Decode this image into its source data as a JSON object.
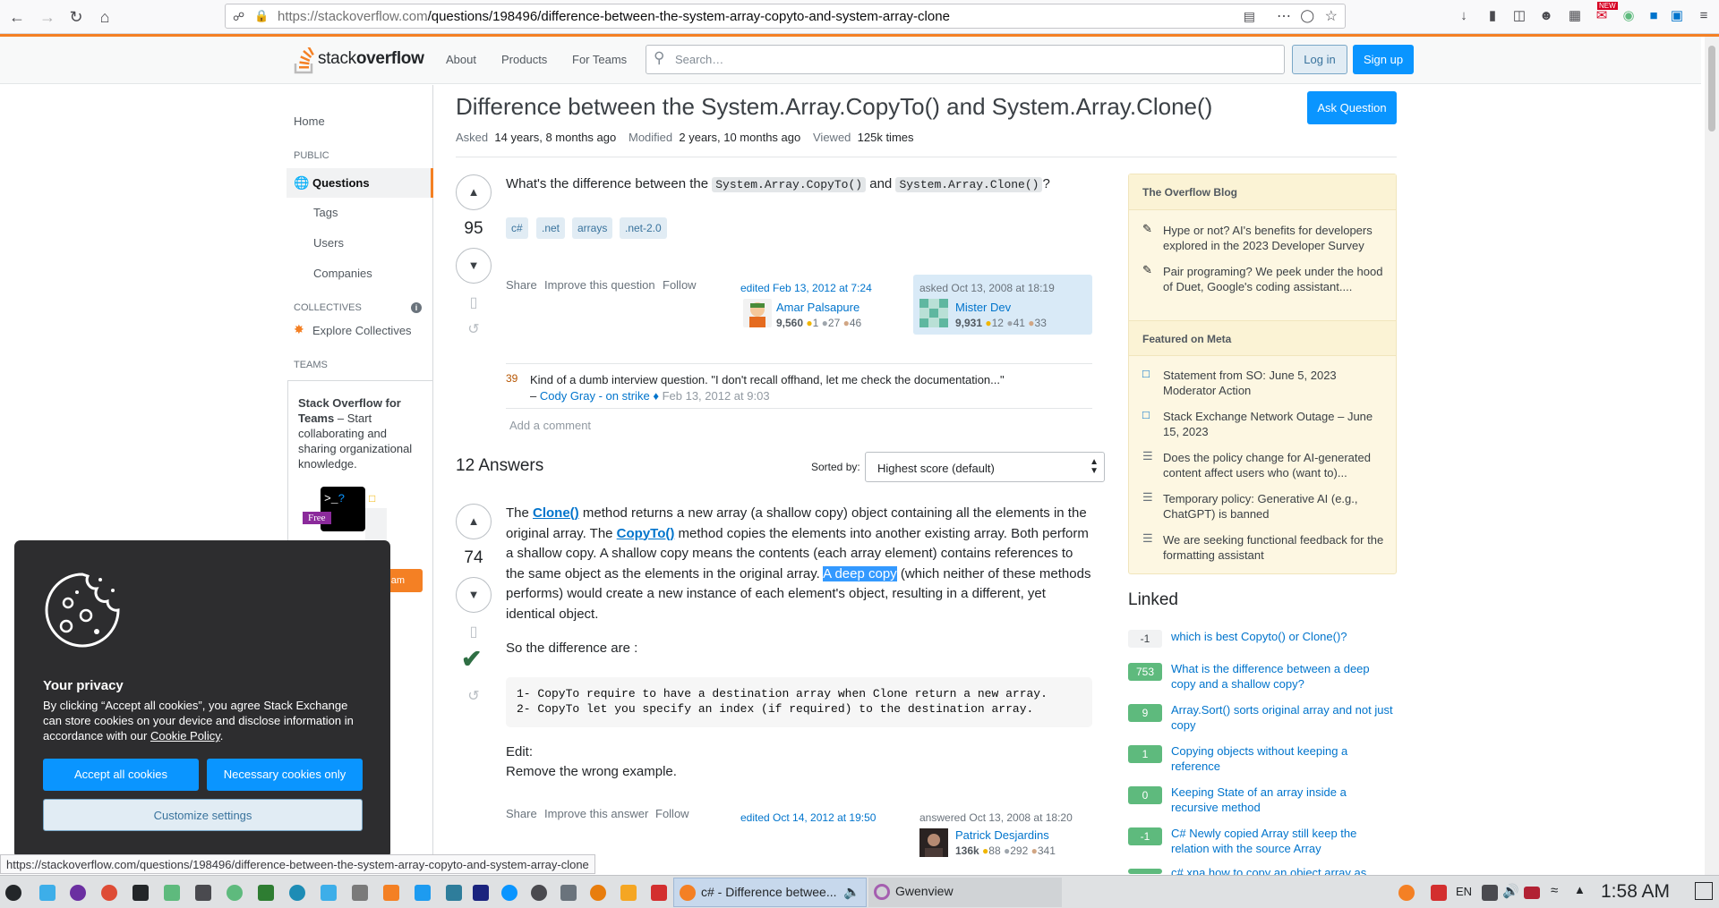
{
  "browser": {
    "url_host": "https://stackoverflow.com",
    "url_path": "/questions/198496/difference-between-the-system-array-copyto-and-system-array-clone",
    "status_url": "https://stackoverflow.com/questions/198496/difference-between-the-system-array-copyto-and-system-array-clone"
  },
  "header": {
    "logo_light": "stack",
    "logo_bold": "overflow",
    "nav": [
      "About",
      "Products",
      "For Teams"
    ],
    "search_placeholder": "Search…",
    "login": "Log in",
    "signup": "Sign up"
  },
  "left_nav": {
    "home": "Home",
    "public": "PUBLIC",
    "questions": "Questions",
    "tags": "Tags",
    "users": "Users",
    "companies": "Companies",
    "collectives": "COLLECTIVES",
    "explore_collectives": "Explore Collectives",
    "teams": "TEAMS",
    "teams_title": "Stack Overflow for Teams",
    "teams_desc": " – Start collaborating and sharing organizational knowledge.",
    "free_badge": "Free",
    "team_button_partial": "am"
  },
  "question": {
    "title": "Difference between the System.Array.CopyTo() and System.Array.Clone()",
    "ask_button": "Ask Question",
    "asked_label": "Asked",
    "asked_value": "14 years, 8 months ago",
    "modified_label": "Modified",
    "modified_value": "2 years, 10 months ago",
    "viewed_label": "Viewed",
    "viewed_value": "125k times",
    "votes": "95",
    "body_before": "What's the difference between the ",
    "code1": "System.Array.CopyTo()",
    "body_mid": " and ",
    "code2": "System.Array.Clone()",
    "body_after": "?",
    "tags": [
      "c#",
      ".net",
      "arrays",
      ".net-2.0"
    ],
    "menu": [
      "Share",
      "Improve this question",
      "Follow"
    ],
    "edited": "edited Feb 13, 2012 at 7:24",
    "editor_name": "Amar Palsapure",
    "editor_rep": "9,560",
    "editor_badges": [
      "1",
      "27",
      "46"
    ],
    "asked_card": "asked Oct 13, 2008 at 18:19",
    "asker_name": "Mister Dev",
    "asker_rep": "9,931",
    "asker_badges": [
      "12",
      "41",
      "33"
    ],
    "comment_score": "39",
    "comment_text": "Kind of a dumb interview question. \"I don't recall offhand, let me check the documentation...\"",
    "comment_dash": "–",
    "comment_user": "Cody Gray - on strike",
    "comment_diamond": "♦",
    "comment_date": "Feb 13, 2012 at 9:03",
    "add_comment": "Add a comment"
  },
  "answers": {
    "count_label": "12 Answers",
    "sorted_by": "Sorted by:",
    "sort_value": "Highest score (default)",
    "votes": "74",
    "p1_a": "The ",
    "p1_clone": "Clone()",
    "p1_b": " method returns a new array (a shallow copy) object containing all the elements in the original array. The ",
    "p1_copyto": "CopyTo()",
    "p1_c": " method copies the elements into another existing array. Both perform a shallow copy. A shallow copy means the contents (each array element) contains references to the same object as the elements in the original array. ",
    "p1_highlight": "A deep copy",
    "p1_d": " (which neither of these methods performs) would create a new instance of each element's object, resulting in a different, yet identical object.",
    "p2": "So the difference are :",
    "code_line1": "1- CopyTo require to have a destination array when Clone return a new array.",
    "code_line2": "2- CopyTo let you specify an index (if required) to the destination array.",
    "edit_label": "Edit:",
    "edit_text": "Remove the wrong example.",
    "menu": [
      "Share",
      "Improve this answer",
      "Follow"
    ],
    "edited": "edited Oct 14, 2012 at 19:50",
    "answered": "answered Oct 13, 2008 at 18:20",
    "answerer_name": "Patrick Desjardins",
    "answerer_rep": "136k",
    "answerer_badges": [
      "88",
      "292",
      "341"
    ]
  },
  "sidebar": {
    "blog_title": "The Overflow Blog",
    "blog_items": [
      "Hype or not? AI's benefits for developers explored in the 2023 Developer Survey",
      "Pair programing? We peek under the hood of Duet, Google's coding assistant...."
    ],
    "meta_title": "Featured on Meta",
    "meta_items": [
      "Statement from SO: June 5, 2023 Moderator Action",
      "Stack Exchange Network Outage – June 15, 2023",
      "Does the policy change for AI-generated content affect users who (want to)...",
      "Temporary policy: Generative AI (e.g., ChatGPT) is banned",
      "We are seeking functional feedback for the formatting assistant"
    ],
    "linked_title": "Linked",
    "linked": [
      {
        "score": "-1",
        "text": "which is best Copyto() or Clone()?"
      },
      {
        "score": "753",
        "text": "What is the difference between a deep copy and a shallow copy?"
      },
      {
        "score": "9",
        "text": "Array.Sort() sorts original array and not just copy"
      },
      {
        "score": "1",
        "text": "Copying objects without keeping a reference"
      },
      {
        "score": "0",
        "text": "Keeping State of an array inside a recursive method"
      },
      {
        "score": "-1",
        "text": "C# Newly copied Array still keep the relation with the source Array"
      },
      {
        "score": "",
        "text": "c# xna how to copy an object array as"
      }
    ]
  },
  "cookie": {
    "title": "Your privacy",
    "body": "By clicking “Accept all cookies”, you agree Stack Exchange can store cookies on your device and disclose information in accordance with our ",
    "policy_link": "Cookie Policy",
    "body_end": ".",
    "accept_all": "Accept all cookies",
    "necessary": "Necessary cookies only",
    "customize": "Customize settings"
  },
  "taskbar": {
    "task1": "c# - Difference betwee...",
    "task2": "Gwenview",
    "lang": "EN",
    "clock": "1:58 AM",
    "new_badge": "NEW"
  },
  "colors": {
    "accent": "#f48024",
    "primary_button": "#0a95ff",
    "link": "#0074cc",
    "accepted": "#2f6f44"
  }
}
